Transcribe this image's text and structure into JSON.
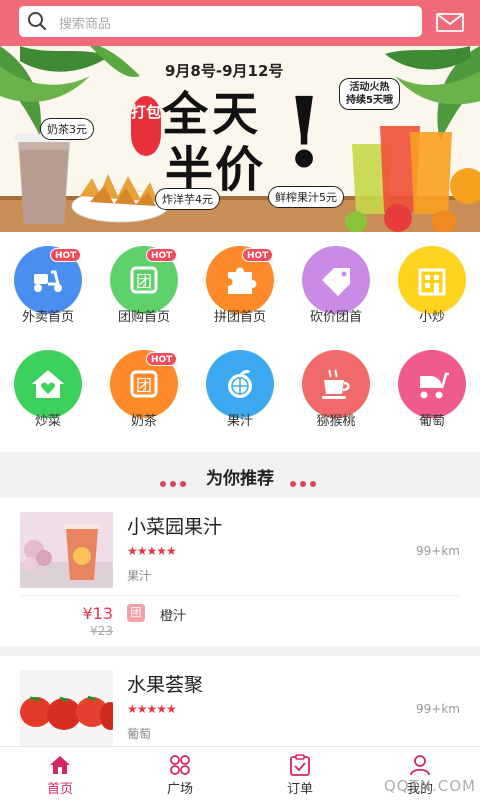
{
  "search": {
    "placeholder": "搜索商品"
  },
  "icons": {
    "search": "search-icon",
    "mail": "mail-icon"
  },
  "colors": {
    "header": "#f06a7a",
    "accent": "#e8344a",
    "active_tab": "#d8255f"
  },
  "banner": {
    "date": "9月8号-9月12号",
    "headline_1": "全天",
    "headline_2": "半价",
    "exclaim": "!",
    "pack": "打包",
    "promo_1": "活动火热",
    "promo_2": "持续5天哦",
    "milk_tea": "奶茶3元",
    "taro": "炸洋芋4元",
    "juice": "鲜榨果汁5元"
  },
  "categories": [
    {
      "label": "外卖首页",
      "hot": "HOT",
      "color": "#4a8ff0",
      "icon": "scooter-icon"
    },
    {
      "label": "团购首页",
      "hot": "HOT",
      "color": "#5fd16a",
      "icon": "group-buy-icon"
    },
    {
      "label": "拼团首页",
      "hot": "HOT",
      "color": "#ff8a2a",
      "icon": "puzzle-icon"
    },
    {
      "label": "砍价团首",
      "hot": "",
      "color": "#c98ae8",
      "icon": "tag-icon"
    },
    {
      "label": "小炒",
      "hot": "",
      "color": "#ffd21f",
      "icon": "building-icon"
    },
    {
      "label": "炒菜",
      "hot": "",
      "color": "#3dd05c",
      "icon": "house-heart-icon"
    },
    {
      "label": "奶茶",
      "hot": "HOT",
      "color": "#ff8a2a",
      "icon": "group-buy-icon"
    },
    {
      "label": "果汁",
      "hot": "",
      "color": "#3ba8f0",
      "icon": "orange-icon"
    },
    {
      "label": "猕猴桃",
      "hot": "",
      "color": "#f06a6a",
      "icon": "teacup-icon"
    },
    {
      "label": "葡萄",
      "hot": "",
      "color": "#f05a8c",
      "icon": "stroller-icon"
    }
  ],
  "section": {
    "title": "为你推荐"
  },
  "shops": [
    {
      "name": "小菜园果汁",
      "stars": "★★★★★",
      "distance": "99+km",
      "category": "果汁",
      "price": "¥13",
      "old_price": "¥23",
      "badge": "团",
      "deal": "橙汁"
    },
    {
      "name": "水果荟聚",
      "stars": "★★★★★",
      "distance": "99+km",
      "category": "葡萄"
    }
  ],
  "tabs": [
    {
      "label": "首页",
      "icon": "home-icon",
      "active": true
    },
    {
      "label": "广场",
      "icon": "grid-icon",
      "active": false
    },
    {
      "label": "订单",
      "icon": "order-icon",
      "active": false
    },
    {
      "label": "我的",
      "icon": "user-icon",
      "active": false
    }
  ],
  "watermark": "QQTN.COM"
}
